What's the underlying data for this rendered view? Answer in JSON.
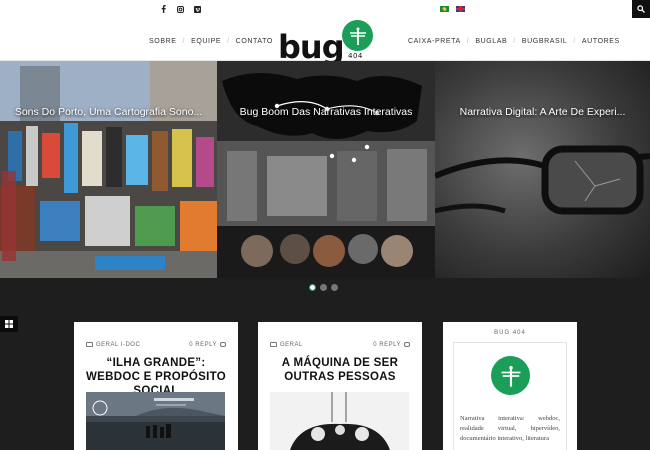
{
  "topbar": {
    "social_icons": [
      "facebook-icon",
      "instagram-icon",
      "vimeo-icon"
    ],
    "languages": [
      "brazil-flag-icon",
      "uk-flag-icon"
    ],
    "search_icon": "search-icon"
  },
  "brand": {
    "logo_text": "bug",
    "logo_number": "404",
    "green": "#1a9e58"
  },
  "nav": {
    "left": [
      "SOBRE",
      "EQUIPE",
      "CONTATO"
    ],
    "right": [
      "CAIXA-PRETA",
      "BUGLAB",
      "BUGBRASIL",
      "AUTORES"
    ]
  },
  "slider": {
    "slides": [
      {
        "title": "Sons Do Porto, Uma Cartografia Sono..."
      },
      {
        "title": "Bug Boom Das Narrativas Interativas"
      },
      {
        "title": "Narrativa Digital: A Arte De Experi..."
      }
    ],
    "active_index": 0,
    "dot_count": 3
  },
  "cards": [
    {
      "categories": "GERAL  I-DOC",
      "replies": "0 REPLY",
      "title": "“ILHA GRANDE”: WEBDOC E PROPÓSITO SOCIAL"
    },
    {
      "categories": "GERAL",
      "replies": "0 REPLY",
      "title": "A MÁQUINA DE SER OUTRAS PESSOAS"
    }
  ],
  "widget": {
    "title": "BUG 404",
    "text": "Narrativa interativa: webdoc, realidade virtual, hipervídeo, documentário interativo, literatura"
  }
}
